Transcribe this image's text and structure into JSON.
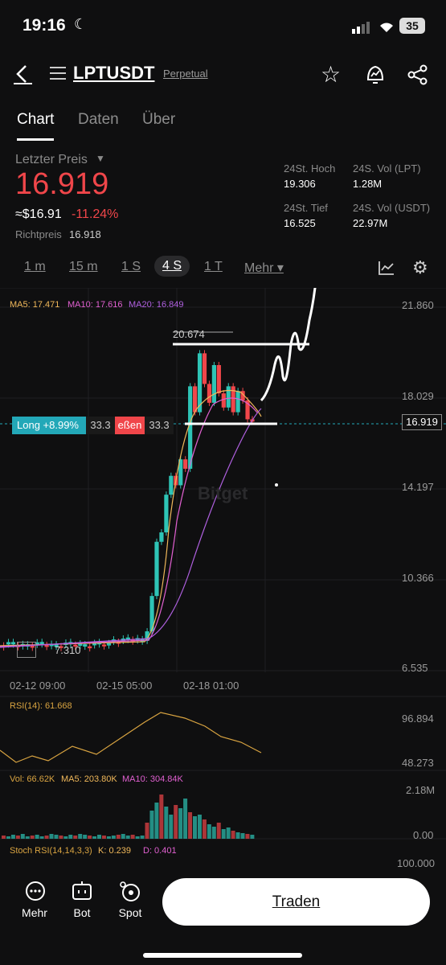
{
  "status": {
    "time": "19:16",
    "battery": "35"
  },
  "header": {
    "symbol": "LPTUSDT",
    "contract_type": "Perpetual"
  },
  "tabs": [
    {
      "label": "Chart"
    },
    {
      "label": "Daten"
    },
    {
      "label": "Über"
    }
  ],
  "price": {
    "label": "Letzter Preis",
    "last": "16.919",
    "usd": "≈$16.91",
    "change": "-11.24%",
    "mark_label": "Richtpreis",
    "mark_value": "16.918"
  },
  "stats": {
    "high_label": "24St. Hoch",
    "high": "19.306",
    "low_label": "24St. Tief",
    "low": "16.525",
    "vol_lpt_label": "24S. Vol (LPT)",
    "vol_lpt": "1.28M",
    "vol_usdt_label": "24S. Vol (USDT)",
    "vol_usdt": "22.97M"
  },
  "intervals": [
    "1 m",
    "15 m",
    "1 S",
    "4 S",
    "1 T",
    "Mehr ▾"
  ],
  "ma_legend": {
    "ma5": "MA5: 17.471",
    "ma10": "MA10: 17.616",
    "ma20": "MA20: 16.849"
  },
  "price_axis": [
    "21.860",
    "18.029",
    "14.197",
    "10.366",
    "6.535"
  ],
  "annotations": {
    "high_marker": "20.674",
    "low_marker": "7.310",
    "current_tag": "16.919",
    "watermark": "Bitget"
  },
  "position": {
    "long_label": "Long +8.99%",
    "qty": "33.3",
    "close_label": "eßen",
    "close_qty": "33.3"
  },
  "time_axis": [
    "02-12 09:00",
    "02-15 05:00",
    "02-18 01:00"
  ],
  "rsi": {
    "label": "RSI(14): 61.668",
    "axis_top": "96.894",
    "axis_bottom": "48.273"
  },
  "volume": {
    "vol": "Vol: 66.62K",
    "ma5": "MA5: 203.80K",
    "ma10": "MA10: 304.84K",
    "axis_top": "2.18M",
    "axis_bottom": "0.00"
  },
  "stoch": {
    "label": "Stoch RSI(14,14,3,3)",
    "k": "K: 0.239",
    "d": "D: 0.401",
    "axis_top": "100.000"
  },
  "bottom_nav": [
    {
      "label": "Mehr"
    },
    {
      "label": "Bot"
    },
    {
      "label": "Spot"
    }
  ],
  "trade_button": "Traden",
  "colors": {
    "up": "#2ec4b6",
    "down": "#f0464a",
    "ma5": "#f0b85a",
    "ma10": "#e060d0",
    "ma20": "#b060e0",
    "accent": "#23a8b8"
  }
}
